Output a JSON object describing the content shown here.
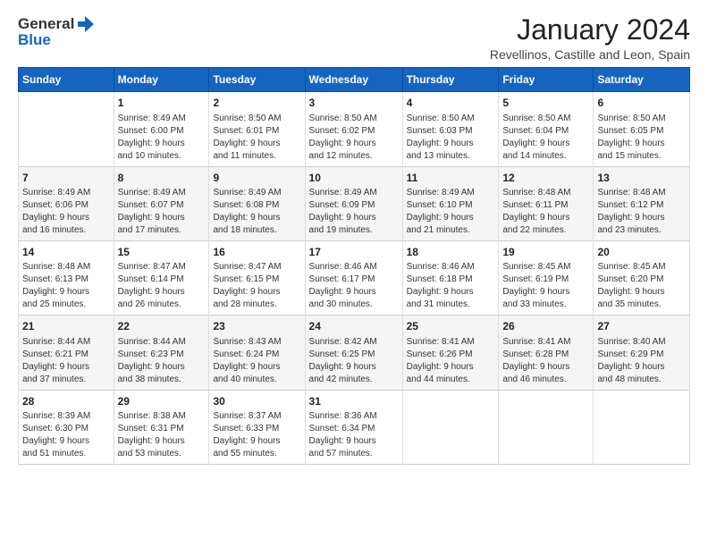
{
  "logo": {
    "general": "General",
    "blue": "Blue"
  },
  "title": "January 2024",
  "subtitle": "Revellinos, Castille and Leon, Spain",
  "days_header": [
    "Sunday",
    "Monday",
    "Tuesday",
    "Wednesday",
    "Thursday",
    "Friday",
    "Saturday"
  ],
  "weeks": [
    [
      {
        "num": "",
        "info": ""
      },
      {
        "num": "1",
        "info": "Sunrise: 8:49 AM\nSunset: 6:00 PM\nDaylight: 9 hours\nand 10 minutes."
      },
      {
        "num": "2",
        "info": "Sunrise: 8:50 AM\nSunset: 6:01 PM\nDaylight: 9 hours\nand 11 minutes."
      },
      {
        "num": "3",
        "info": "Sunrise: 8:50 AM\nSunset: 6:02 PM\nDaylight: 9 hours\nand 12 minutes."
      },
      {
        "num": "4",
        "info": "Sunrise: 8:50 AM\nSunset: 6:03 PM\nDaylight: 9 hours\nand 13 minutes."
      },
      {
        "num": "5",
        "info": "Sunrise: 8:50 AM\nSunset: 6:04 PM\nDaylight: 9 hours\nand 14 minutes."
      },
      {
        "num": "6",
        "info": "Sunrise: 8:50 AM\nSunset: 6:05 PM\nDaylight: 9 hours\nand 15 minutes."
      }
    ],
    [
      {
        "num": "7",
        "info": "Sunrise: 8:49 AM\nSunset: 6:06 PM\nDaylight: 9 hours\nand 16 minutes."
      },
      {
        "num": "8",
        "info": "Sunrise: 8:49 AM\nSunset: 6:07 PM\nDaylight: 9 hours\nand 17 minutes."
      },
      {
        "num": "9",
        "info": "Sunrise: 8:49 AM\nSunset: 6:08 PM\nDaylight: 9 hours\nand 18 minutes."
      },
      {
        "num": "10",
        "info": "Sunrise: 8:49 AM\nSunset: 6:09 PM\nDaylight: 9 hours\nand 19 minutes."
      },
      {
        "num": "11",
        "info": "Sunrise: 8:49 AM\nSunset: 6:10 PM\nDaylight: 9 hours\nand 21 minutes."
      },
      {
        "num": "12",
        "info": "Sunrise: 8:48 AM\nSunset: 6:11 PM\nDaylight: 9 hours\nand 22 minutes."
      },
      {
        "num": "13",
        "info": "Sunrise: 8:48 AM\nSunset: 6:12 PM\nDaylight: 9 hours\nand 23 minutes."
      }
    ],
    [
      {
        "num": "14",
        "info": "Sunrise: 8:48 AM\nSunset: 6:13 PM\nDaylight: 9 hours\nand 25 minutes."
      },
      {
        "num": "15",
        "info": "Sunrise: 8:47 AM\nSunset: 6:14 PM\nDaylight: 9 hours\nand 26 minutes."
      },
      {
        "num": "16",
        "info": "Sunrise: 8:47 AM\nSunset: 6:15 PM\nDaylight: 9 hours\nand 28 minutes."
      },
      {
        "num": "17",
        "info": "Sunrise: 8:46 AM\nSunset: 6:17 PM\nDaylight: 9 hours\nand 30 minutes."
      },
      {
        "num": "18",
        "info": "Sunrise: 8:46 AM\nSunset: 6:18 PM\nDaylight: 9 hours\nand 31 minutes."
      },
      {
        "num": "19",
        "info": "Sunrise: 8:45 AM\nSunset: 6:19 PM\nDaylight: 9 hours\nand 33 minutes."
      },
      {
        "num": "20",
        "info": "Sunrise: 8:45 AM\nSunset: 6:20 PM\nDaylight: 9 hours\nand 35 minutes."
      }
    ],
    [
      {
        "num": "21",
        "info": "Sunrise: 8:44 AM\nSunset: 6:21 PM\nDaylight: 9 hours\nand 37 minutes."
      },
      {
        "num": "22",
        "info": "Sunrise: 8:44 AM\nSunset: 6:23 PM\nDaylight: 9 hours\nand 38 minutes."
      },
      {
        "num": "23",
        "info": "Sunrise: 8:43 AM\nSunset: 6:24 PM\nDaylight: 9 hours\nand 40 minutes."
      },
      {
        "num": "24",
        "info": "Sunrise: 8:42 AM\nSunset: 6:25 PM\nDaylight: 9 hours\nand 42 minutes."
      },
      {
        "num": "25",
        "info": "Sunrise: 8:41 AM\nSunset: 6:26 PM\nDaylight: 9 hours\nand 44 minutes."
      },
      {
        "num": "26",
        "info": "Sunrise: 8:41 AM\nSunset: 6:28 PM\nDaylight: 9 hours\nand 46 minutes."
      },
      {
        "num": "27",
        "info": "Sunrise: 8:40 AM\nSunset: 6:29 PM\nDaylight: 9 hours\nand 48 minutes."
      }
    ],
    [
      {
        "num": "28",
        "info": "Sunrise: 8:39 AM\nSunset: 6:30 PM\nDaylight: 9 hours\nand 51 minutes."
      },
      {
        "num": "29",
        "info": "Sunrise: 8:38 AM\nSunset: 6:31 PM\nDaylight: 9 hours\nand 53 minutes."
      },
      {
        "num": "30",
        "info": "Sunrise: 8:37 AM\nSunset: 6:33 PM\nDaylight: 9 hours\nand 55 minutes."
      },
      {
        "num": "31",
        "info": "Sunrise: 8:36 AM\nSunset: 6:34 PM\nDaylight: 9 hours\nand 57 minutes."
      },
      {
        "num": "",
        "info": ""
      },
      {
        "num": "",
        "info": ""
      },
      {
        "num": "",
        "info": ""
      }
    ]
  ]
}
